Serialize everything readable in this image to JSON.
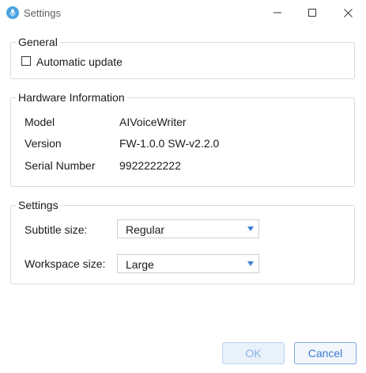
{
  "window": {
    "title": "Settings",
    "icon": "app-microphone-icon",
    "controls": [
      "minimize-icon",
      "maximize-icon",
      "close-icon"
    ]
  },
  "general": {
    "legend": "General",
    "automatic_update": {
      "label": "Automatic update",
      "checked": false
    }
  },
  "hardware": {
    "legend": "Hardware Information",
    "rows": [
      {
        "label": "Model",
        "value": "AIVoiceWriter"
      },
      {
        "label": "Version",
        "value": "FW-1.0.0 SW-v2.2.0"
      },
      {
        "label": "Serial Number",
        "value": "9922222222"
      }
    ]
  },
  "settings": {
    "legend": "Settings",
    "subtitle_size": {
      "label": "Subtitle size:",
      "value": "Regular"
    },
    "workspace_size": {
      "label": "Workspace size:",
      "value": "Large"
    }
  },
  "footer": {
    "ok_label": "OK",
    "cancel_label": "Cancel"
  },
  "colors": {
    "accent": "#3b7bd3",
    "border": "#d9d9d9"
  }
}
